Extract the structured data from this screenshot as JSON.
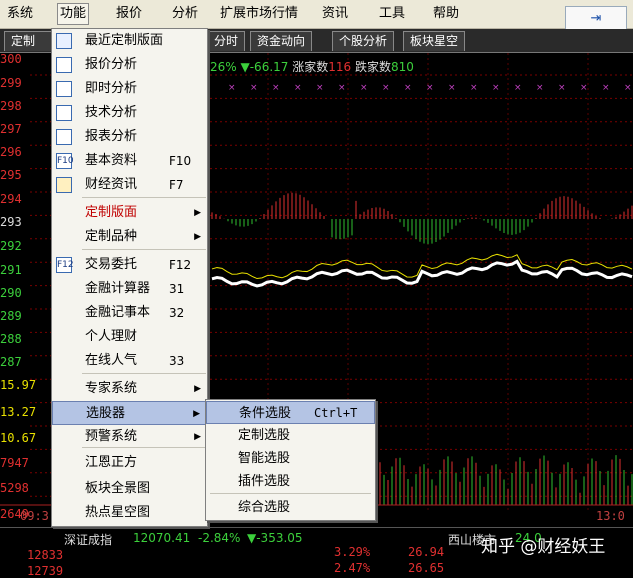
{
  "menubar": {
    "items": [
      "系统",
      "功能",
      "报价",
      "分析",
      "扩展市场行情",
      "资讯",
      "工具",
      "帮助"
    ],
    "right_button_icon": "dock-arrow-icon"
  },
  "tabs": [
    "定制",
    "分时",
    "资金动向",
    "个股分析",
    "板块星空"
  ],
  "status": {
    "pct": "26%",
    "change": "▼-66.17",
    "up_label": "涨家数",
    "up_count": "116",
    "down_label": "跌家数",
    "down_count": "810"
  },
  "y_labels": [
    "300",
    "299",
    "298",
    "297",
    "296",
    "295",
    "294",
    "293",
    "292",
    "291",
    "290",
    "289",
    "288",
    "287",
    "15.97",
    "13.27",
    "10.67",
    "7947",
    "5298",
    "2649"
  ],
  "time_labels": {
    "start": "09:3",
    "end": "13:0"
  },
  "index_bar": {
    "name": "深证成指",
    "value": "12070.41",
    "pct": "-2.84%",
    "change": "▼-353.05",
    "left_value": "12833",
    "left_value2": "12739",
    "mid_pct": "3.29%",
    "mid_pct2": "2.47%",
    "mid_val": "26.94",
    "mid_val2": "26.65",
    "right_label": "西山楼市",
    "right_value": "24.0"
  },
  "menu": {
    "items": [
      {
        "label": "最近定制版面",
        "icon": "recent-layout-icon"
      },
      {
        "label": "报价分析",
        "icon": "quote-grid-icon"
      },
      {
        "label": "即时分析",
        "icon": "line-chart-icon"
      },
      {
        "label": "技术分析",
        "icon": "candlestick-icon"
      },
      {
        "label": "报表分析",
        "icon": "report-table-icon"
      },
      {
        "label": "基本资料",
        "shortcut": "F10",
        "icon": "f10-icon",
        "icon_text": "F10"
      },
      {
        "label": "财经资讯",
        "shortcut": "F7",
        "icon": "news-icon"
      },
      {
        "label": "定制版面",
        "arrow": "▶"
      },
      {
        "label": "定制品种",
        "arrow": "▶"
      },
      {
        "label": "交易委托",
        "shortcut": "F12",
        "icon": "f12-icon",
        "icon_text": "F12"
      },
      {
        "label": "金融计算器",
        "shortcut": "31"
      },
      {
        "label": "金融记事本",
        "shortcut": "32"
      },
      {
        "label": "个人理财"
      },
      {
        "label": "在线人气",
        "shortcut": "33"
      },
      {
        "label": "专家系统",
        "arrow": "▶"
      },
      {
        "label": "选股器",
        "arrow": "▶"
      },
      {
        "label": "预警系统",
        "arrow": "▶"
      },
      {
        "label": "江恩正方"
      },
      {
        "label": "板块全景图"
      },
      {
        "label": "热点星空图"
      }
    ]
  },
  "submenu": {
    "items": [
      {
        "label": "条件选股",
        "shortcut": "Ctrl+T"
      },
      {
        "label": "定制选股"
      },
      {
        "label": "智能选股"
      },
      {
        "label": "插件选股"
      },
      {
        "label": "综合选股"
      }
    ]
  },
  "watermark": "知乎 @财经妖王",
  "colors": {
    "up": "#e03030",
    "down": "#30c030",
    "bg": "#000000",
    "menu_bg": "#f5f4ee",
    "highlight": "#b4c4e4"
  }
}
